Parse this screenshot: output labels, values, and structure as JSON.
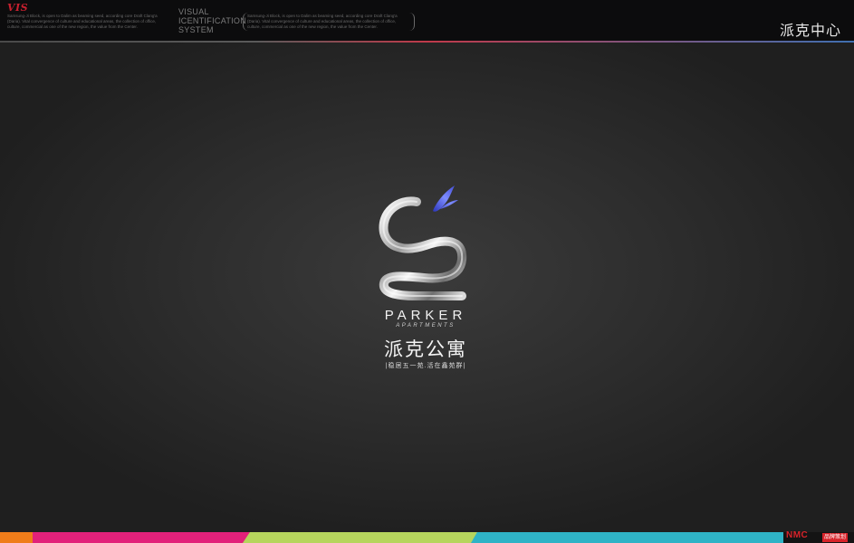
{
  "header": {
    "badge": "VIS",
    "intro": "Samsung-Ji Block, is open to Dalim as beaming seed, according core Draft Clang'a (Daria). Vital convergence of culture and educational areas, the collection of office, culture, commercial as one of the new region, the value from the Center.",
    "vis_title": [
      "VISUAL",
      "ICENTIFICATION",
      "SYSTEM"
    ],
    "bracket_text": "Samsung-Ji Block, is open to Dalim as beaming seed, according core Draft Clang'a (Daria). Vital convergence of culture and educational areas, the collection of office, culture, commercial as one of the new region, the value from the Center.",
    "section_title": "派克中心"
  },
  "logo": {
    "brand_name": "PARKER",
    "brand_sub": "APARTMENTS",
    "brand_cn": "派克公寓",
    "tagline": "|稳居五一苑.活在鑫苑群|",
    "colors": {
      "chrome": "#e0e0e0",
      "flame": "#3f4fd6"
    }
  },
  "footer": {
    "logo_text": "NMC",
    "tag": "品牌策划",
    "stripe_colors": [
      "#ef7d1a",
      "#e2217a",
      "#b6d55d",
      "#2fb3c6"
    ]
  }
}
